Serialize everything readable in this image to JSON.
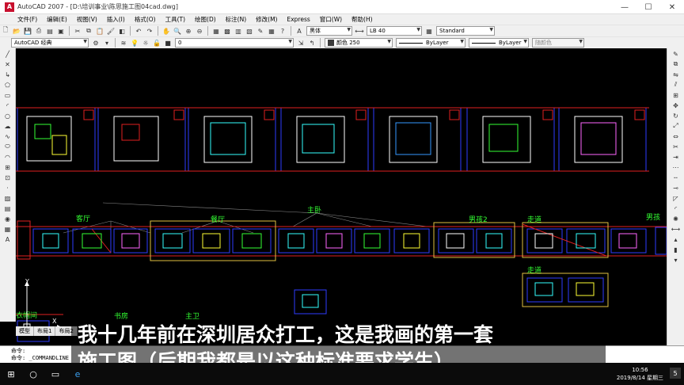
{
  "window": {
    "title": "AutoCAD 2007 - [D:\\培训事业\\陈思施工图04cad.dwg]",
    "minimize_glyph": "—",
    "maximize_glyph": "☐",
    "close_glyph": "✕"
  },
  "menu": [
    "文件(F)",
    "编辑(E)",
    "视图(V)",
    "插入(I)",
    "格式(O)",
    "工具(T)",
    "绘图(D)",
    "标注(N)",
    "修改(M)",
    "Express",
    "窗口(W)",
    "帮助(H)"
  ],
  "toolbar_styles": {
    "text_font": "黑体",
    "dim_style": "LB 40",
    "table_style": "Standard"
  },
  "toolbar_layers": {
    "workspace": "AutoCAD 经典",
    "layer": "0",
    "color": "颜色 250",
    "linetype": "ByLayer",
    "lineweight": "ByLayer",
    "plotstyle": "随颜色"
  },
  "drawing_labels": {
    "keting": "客厅",
    "canting": "餐厅",
    "zhuwo": "主卧",
    "nanhai2": "男孩2",
    "zoudao1": "走道",
    "nanhai_cut": "男孩",
    "zoudao2": "走道",
    "yimaojian": "衣帽间",
    "shufang": "书房",
    "zhuwei": "主卫"
  },
  "model_tabs": [
    "模型",
    "布局1",
    "布局2"
  ],
  "ucs": {
    "y": "Y",
    "x": "X"
  },
  "command_lines": [
    "命令:",
    "命令: _COMMANDLINE",
    "命令:"
  ],
  "subtitle": {
    "line1": "我十几年前在深圳居众打工，这是我画的第一套",
    "line2": "施工图（后期我都是以这种标准要求学生）"
  },
  "taskbar": {
    "time": "10:56",
    "date": "2019/8/14 星期三",
    "notification_count": "5"
  },
  "colors": {
    "canvas": "#000000",
    "frame_blue": "#2e3cff",
    "frame_red": "#e02020",
    "frame_yellow": "#e0c040",
    "label_green": "#33ff33"
  }
}
